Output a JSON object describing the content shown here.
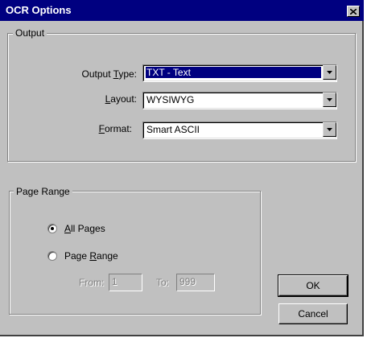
{
  "window": {
    "title": "OCR Options",
    "close_icon": "close-icon"
  },
  "output_group": {
    "label": "Output",
    "output_type": {
      "label_pre": "Output ",
      "label_accel": "T",
      "label_post": "ype:",
      "value": "TXT - Text"
    },
    "layout": {
      "label_pre": "",
      "label_accel": "L",
      "label_post": "ayout:",
      "value": "WYSIWYG"
    },
    "format": {
      "label_pre": "",
      "label_accel": "F",
      "label_post": "ormat:",
      "value": "Smart ASCII"
    }
  },
  "page_range_group": {
    "label": "Page Range",
    "all_pages": {
      "accel": "A",
      "rest": "ll Pages",
      "selected": true
    },
    "page_range": {
      "pre": "Page ",
      "accel": "R",
      "rest": "ange",
      "selected": false
    },
    "from_label": "From:",
    "from_value": "1",
    "to_label": "To:",
    "to_value": "999"
  },
  "buttons": {
    "ok": "OK",
    "cancel": "Cancel"
  },
  "colors": {
    "titlebar": "#000080",
    "face": "#c0c0c0",
    "selection": "#000080"
  }
}
